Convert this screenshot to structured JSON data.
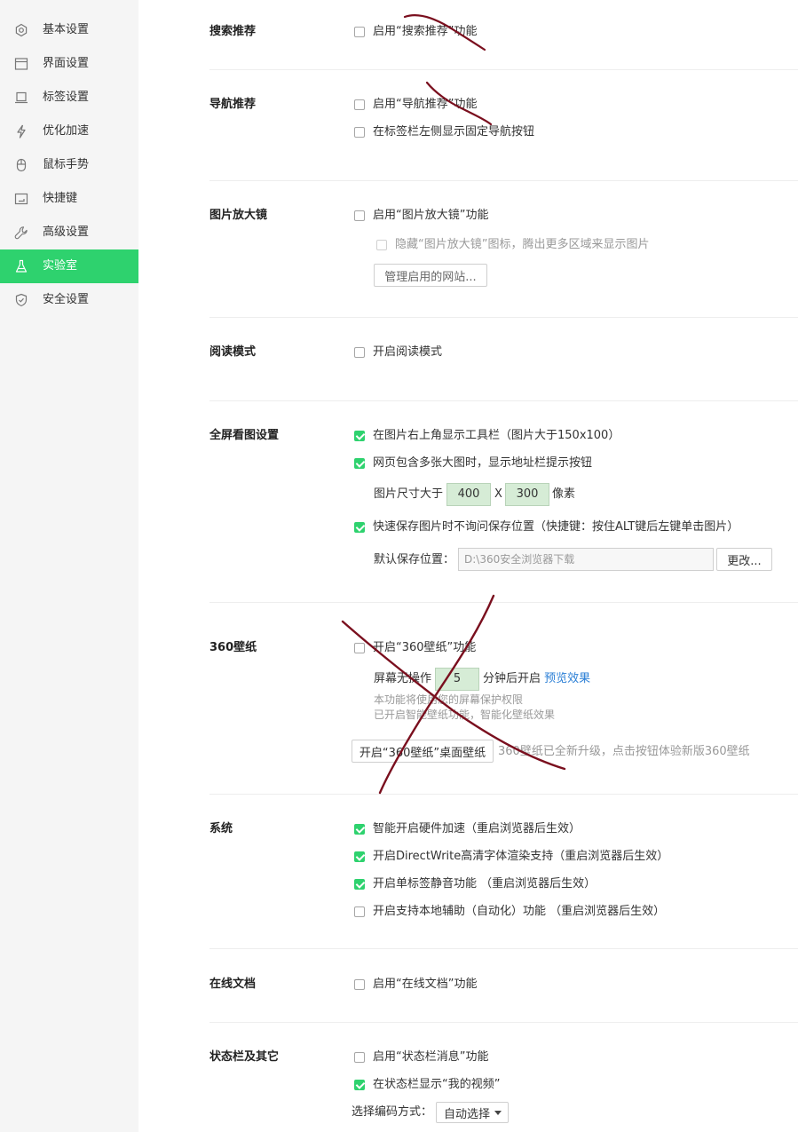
{
  "sidebar": {
    "items": [
      {
        "label": "基本设置",
        "icon": "gear-icon",
        "active": false
      },
      {
        "label": "界面设置",
        "icon": "window-icon",
        "active": false
      },
      {
        "label": "标签设置",
        "icon": "tab-icon",
        "active": false
      },
      {
        "label": "优化加速",
        "icon": "lightning-icon",
        "active": false
      },
      {
        "label": "鼠标手势",
        "icon": "mouse-icon",
        "active": false
      },
      {
        "label": "快捷键",
        "icon": "keyboard-icon",
        "active": false
      },
      {
        "label": "高级设置",
        "icon": "wrench-icon",
        "active": false
      },
      {
        "label": "实验室",
        "icon": "flask-icon",
        "active": true
      },
      {
        "label": "安全设置",
        "icon": "shield-icon",
        "active": false
      }
    ]
  },
  "colors": {
    "accent": "#2ed26e",
    "link": "#2b7fd6",
    "input_bg": "#d6ecd6",
    "annotation": "#7a0f1e"
  },
  "sections": {
    "search_rec": {
      "title": "搜索推荐",
      "enable": {
        "label": "启用“搜索推荐”功能",
        "checked": false
      }
    },
    "nav_rec": {
      "title": "导航推荐",
      "enable": {
        "label": "启用“导航推荐”功能",
        "checked": false
      },
      "fixed_button": {
        "label": "在标签栏左侧显示固定导航按钮",
        "checked": false
      }
    },
    "magnifier": {
      "title": "图片放大镜",
      "enable": {
        "label": "启用“图片放大镜”功能",
        "checked": false
      },
      "hide_icon": {
        "label": "隐藏“图片放大镜”图标，腾出更多区域来显示图片",
        "checked": false
      },
      "manage_button": "管理启用的网站..."
    },
    "reader": {
      "title": "阅读模式",
      "enable": {
        "label": "开启阅读模式",
        "checked": false
      }
    },
    "fullscreen": {
      "title": "全屏看图设置",
      "toolbar": {
        "label": "在图片右上角显示工具栏（图片大于150x100）",
        "checked": true
      },
      "address_hint": {
        "label": "网页包含多张大图时，显示地址栏提示按钮",
        "checked": true
      },
      "size_label": "图片尺寸大于",
      "width": "400",
      "times": "X",
      "height": "300",
      "unit": "像素",
      "quick_save": {
        "label": "快速保存图片时不询问保存位置（快捷键：按住ALT键后左键单击图片）",
        "checked": true
      },
      "save_path_label": "默认保存位置：",
      "save_path": "D:\\360安全浏览器下载",
      "change_button": "更改..."
    },
    "wallpaper": {
      "title": "360壁纸",
      "enable": {
        "label": "开启“360壁纸”功能",
        "checked": false
      },
      "idle_prefix": "屏幕无操作",
      "idle_minutes": "5",
      "idle_suffix": "分钟后开启",
      "preview_link": "预览效果",
      "note1": "本功能将使用您的屏幕保护权限",
      "note2": "已开启智能壁纸功能，智能化壁纸效果",
      "desktop_button": "开启“360壁纸”桌面壁纸",
      "upgrade_note": "360壁纸已全新升级，点击按钮体验新版360壁纸"
    },
    "system": {
      "title": "系统",
      "hw_accel": {
        "label": "智能开启硬件加速（重启浏览器后生效）",
        "checked": true
      },
      "directwrite": {
        "label": "开启DirectWrite高清字体渲染支持（重启浏览器后生效）",
        "checked": true
      },
      "tab_mute": {
        "label": "开启单标签静音功能 （重启浏览器后生效）",
        "checked": true
      },
      "automation": {
        "label": "开启支持本地辅助（自动化）功能 （重启浏览器后生效）",
        "checked": false
      }
    },
    "online_docs": {
      "title": "在线文档",
      "enable": {
        "label": "启用“在线文档”功能",
        "checked": false
      }
    },
    "statusbar": {
      "title": "状态栏及其它",
      "messages": {
        "label": "启用“状态栏消息”功能",
        "checked": false
      },
      "my_videos": {
        "label": "在状态栏显示“我的视频”",
        "checked": true
      },
      "encoding_label": "选择编码方式：",
      "encoding_value": "自动选择"
    }
  }
}
